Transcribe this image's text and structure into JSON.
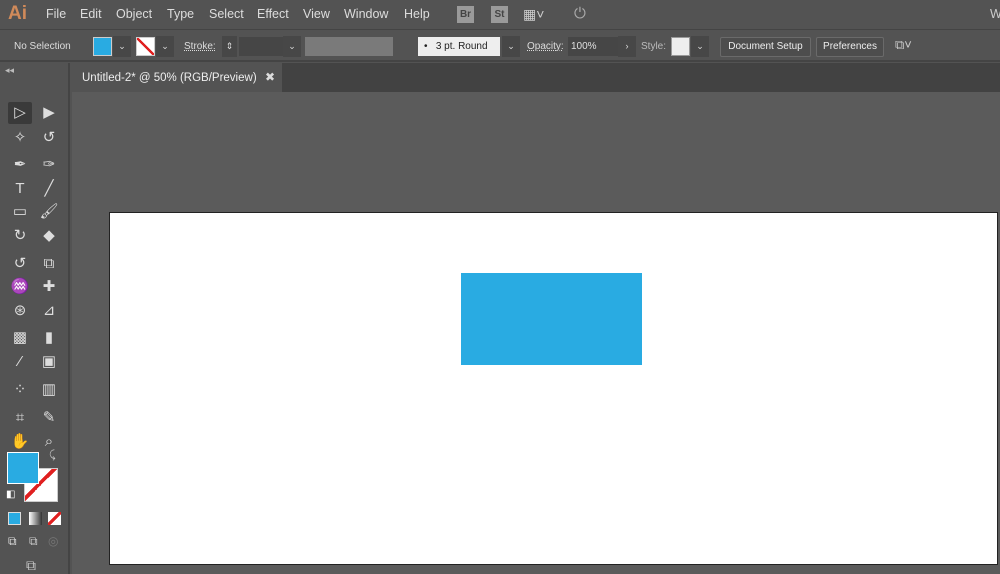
{
  "app": {
    "logo": "Ai",
    "menu": [
      "File",
      "Edit",
      "Object",
      "Type",
      "Select",
      "Effect",
      "View",
      "Window",
      "Help"
    ],
    "bridge": "Br",
    "stock": "St",
    "workspace_initial": "W"
  },
  "control": {
    "selection": "No Selection",
    "fill_color": "#29abe2",
    "stroke_label": "Stroke:",
    "brush": "3 pt. Round",
    "opacity_label": "Opacity:",
    "opacity": "100%",
    "style_label": "Style:",
    "document_setup": "Document Setup",
    "preferences": "Preferences"
  },
  "tab": {
    "title": "Untitled-2* @ 50% (RGB/Preview)",
    "close": "✖"
  },
  "canvas": {
    "rect_color": "#29abe2",
    "artboard_color": "#ffffff"
  },
  "tools": [
    [
      "selection",
      "direct-selection"
    ],
    [
      "magic-wand",
      "lasso"
    ],
    [
      "pen",
      "curvature"
    ],
    [
      "type",
      "line-segment"
    ],
    [
      "rectangle",
      "paintbrush"
    ],
    [
      "shaper",
      "eraser"
    ],
    [
      "rotate",
      "scale"
    ],
    [
      "warp",
      "puppet-warp"
    ],
    [
      "shape-builder",
      "perspective-grid"
    ],
    [
      "mesh",
      "gradient"
    ],
    [
      "eyedropper",
      "blend"
    ],
    [
      "symbol-sprayer",
      "column-graph"
    ],
    [
      "artboard",
      "slice"
    ],
    [
      "hand",
      "zoom"
    ]
  ]
}
